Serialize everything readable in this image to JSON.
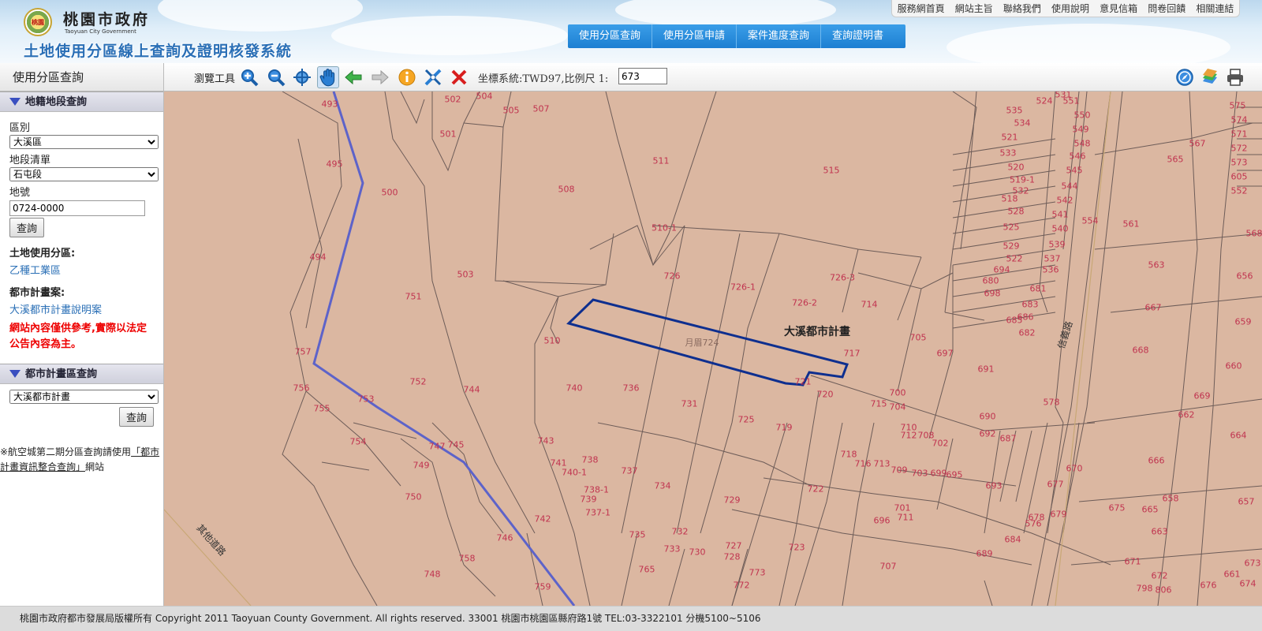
{
  "header": {
    "gov_name": "桃園市政府",
    "gov_en": "Taoyuan City Government",
    "logo_text": "桃園",
    "system_title": "土地使用分區線上查詢及證明核發系統",
    "nav": [
      "使用分區查詢",
      "使用分區申請",
      "案件進度查詢",
      "查詢證明書"
    ],
    "quick_links": [
      "服務網首頁",
      "網站主旨",
      "聯絡我們",
      "使用說明",
      "意見信箱",
      "問卷回饋",
      "相關連結"
    ]
  },
  "left_panel": {
    "title": "使用分區查詢",
    "cadastral": {
      "heading": "地籍地段查詢",
      "district_label": "區別",
      "district_value": "大溪區",
      "section_label": "地段清單",
      "section_value": "石屯段",
      "lot_label": "地號",
      "lot_value": "0724-0000",
      "query_button": "查詢",
      "zone_label": "土地使用分區:",
      "zone_value": "乙種工業區",
      "plan_label": "都市計畫案:",
      "plan_value": "大溪都市計畫說明案",
      "warning": "網站內容僅供參考,實際以法定公告內容為主。"
    },
    "urban_plan": {
      "heading": "都市計畫區查詢",
      "plan_value": "大溪都市計畫",
      "query_button": "查詢"
    },
    "note_prefix": "※航空城第二期分區查詢請使用",
    "note_link": "「都市計畫資訊整合查詢」",
    "note_suffix": "網站"
  },
  "toolbar": {
    "browse_label": "瀏覽工具",
    "icons": [
      "zoom-in-icon",
      "zoom-out-icon",
      "full-extent-icon",
      "pan-hand-icon",
      "previous-extent-icon",
      "next-extent-icon",
      "info-icon",
      "measure-icon",
      "clear-icon",
      "navigation-icon",
      "layers-icon",
      "print-icon"
    ],
    "coord_text": "坐標系統:TWD97,比例尺 1:",
    "scale_value": "673"
  },
  "map": {
    "plan_label": "大溪都市計畫",
    "road_labels": [
      "信義路",
      "其他道路"
    ],
    "selected_parcel": "724",
    "selected_prefix": "月眉",
    "parcels": [
      "493",
      "502",
      "504",
      "505",
      "507",
      "501",
      "495",
      "500",
      "508",
      "511",
      "515",
      "494",
      "503",
      "510-1",
      "726",
      "726-1",
      "726-2",
      "726-3",
      "714",
      "751",
      "510",
      "757",
      "756",
      "755",
      "752",
      "753",
      "744",
      "740",
      "736",
      "731",
      "725",
      "721",
      "720",
      "719",
      "717",
      "705",
      "697",
      "691",
      "700",
      "704",
      "715",
      "710",
      "712",
      "708",
      "702",
      "718",
      "716",
      "713",
      "709",
      "703",
      "699",
      "695",
      "690",
      "692",
      "687",
      "693",
      "754",
      "747",
      "745",
      "743",
      "741",
      "740-1",
      "738",
      "737",
      "738-1",
      "739",
      "734",
      "729",
      "722",
      "749",
      "750",
      "742",
      "737-1",
      "732",
      "735",
      "733",
      "730",
      "727",
      "728",
      "746",
      "758",
      "748",
      "759",
      "765",
      "772",
      "773",
      "723",
      "707",
      "696",
      "701",
      "711",
      "689",
      "684",
      "685",
      "686",
      "682",
      "683",
      "681",
      "680",
      "698",
      "694",
      "522",
      "529",
      "525",
      "528",
      "518",
      "532",
      "519-1",
      "520",
      "533",
      "521",
      "534",
      "535",
      "524",
      "531",
      "551",
      "550",
      "549",
      "548",
      "546",
      "545",
      "544",
      "542",
      "541",
      "540",
      "539",
      "537",
      "536",
      "554",
      "561",
      "565",
      "567",
      "568",
      "563",
      "656",
      "667",
      "659",
      "668",
      "660",
      "669",
      "662",
      "664",
      "666",
      "657",
      "658",
      "665",
      "663",
      "661",
      "671",
      "672",
      "674",
      "673",
      "676",
      "675",
      "677",
      "670",
      "679",
      "678",
      "578",
      "576",
      "575",
      "574",
      "571",
      "572",
      "573",
      "605",
      "552"
    ],
    "road_parcels": [
      "798",
      "806"
    ]
  },
  "footer": {
    "text": "桃園市政府都市發展局版權所有 Copyright 2011 Taoyuan County Government. All rights reserved. 33001 桃園市桃園區縣府路1號 TEL:03-3322101 分機5100~5106"
  }
}
